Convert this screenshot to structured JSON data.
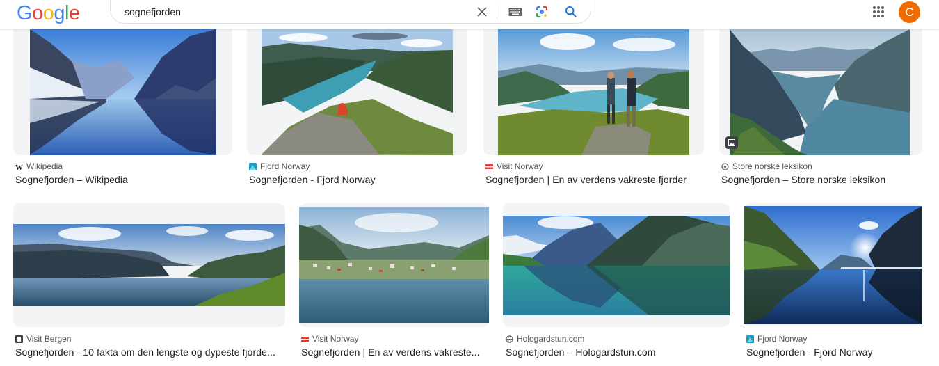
{
  "header": {
    "logo_letters": [
      "G",
      "o",
      "o",
      "g",
      "l",
      "e"
    ],
    "search_value": "sognefjorden",
    "avatar_letter": "C"
  },
  "results": [
    {
      "source": "Wikipedia",
      "title": "Sognefjorden – Wikipedia"
    },
    {
      "source": "Fjord Norway",
      "title": "Sognefjorden - Fjord Norway"
    },
    {
      "source": "Visit Norway",
      "title": "Sognefjorden | En av verdens vakreste fjorder"
    },
    {
      "source": "Store norske leksikon",
      "title": "Sognefjorden – Store norske leksikon"
    },
    {
      "source": "Visit Bergen",
      "title": "Sognefjorden - 10 fakta om den lengste og dypeste fjorde..."
    },
    {
      "source": "Visit Norway",
      "title": "Sognefjorden | En av verdens vakreste..."
    },
    {
      "source": "Hologardstun.com",
      "title": "Sognefjorden – Hologardstun.com"
    },
    {
      "source": "Fjord Norway",
      "title": "Sognefjorden - Fjord Norway"
    }
  ],
  "colors": {
    "accent": "#1a73e8",
    "avatar": "#ef6c00",
    "card_bg": "#f1f3f4",
    "visit_norway": "#e53935",
    "fjord_norway": "#1b9ec9"
  }
}
